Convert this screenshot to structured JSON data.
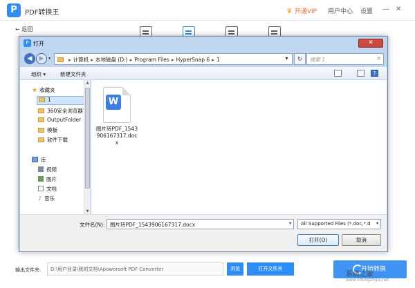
{
  "app": {
    "title": "PDF转换王",
    "logo_glyph": "P",
    "vip": "开通VIP",
    "user_center": "用户中心",
    "settings": "设置",
    "minimize": "—",
    "restore": "▢",
    "close": "✕",
    "back": "← 返回",
    "accent": "#2f8ef5"
  },
  "bottom": {
    "output_label": "输出文件夹:",
    "output_path": "D:\\用户目录\\我的文档\\Apowersoft PDF Converter",
    "browse": "浏览",
    "open_folder": "打开文件夹",
    "start": "开始转换"
  },
  "dialog": {
    "title": "打开",
    "close_glyph": "✕",
    "address": {
      "segments": [
        "计算机",
        "本地磁盘 (D:)",
        "Program Files",
        "HyperSnap 6",
        "1"
      ]
    },
    "search_placeholder": "搜索 1",
    "commands": {
      "organize": "组织 ▾",
      "new_folder": "新建文件夹"
    },
    "nav": {
      "favorites": "收藏夹",
      "folders": [
        "1",
        "360安全浏览器下",
        "OutputFolder",
        "模板",
        "软件下载"
      ],
      "library": "库",
      "library_items": [
        "视频",
        "图片",
        "文档",
        "音乐"
      ]
    },
    "file": {
      "badge": "W",
      "name": "图片转PDF_1543906167317.docx"
    },
    "footer": {
      "filename_label": "文件名(N):",
      "filename_value": "图片转PDF_1543906167317.docx",
      "filetype": "All Supported Files (*.doc,*.d",
      "open": "打开(O)",
      "cancel": "取消"
    }
  },
  "watermark": {
    "line1": "系统之家",
    "line2": "www.xitongzhijia.net"
  }
}
